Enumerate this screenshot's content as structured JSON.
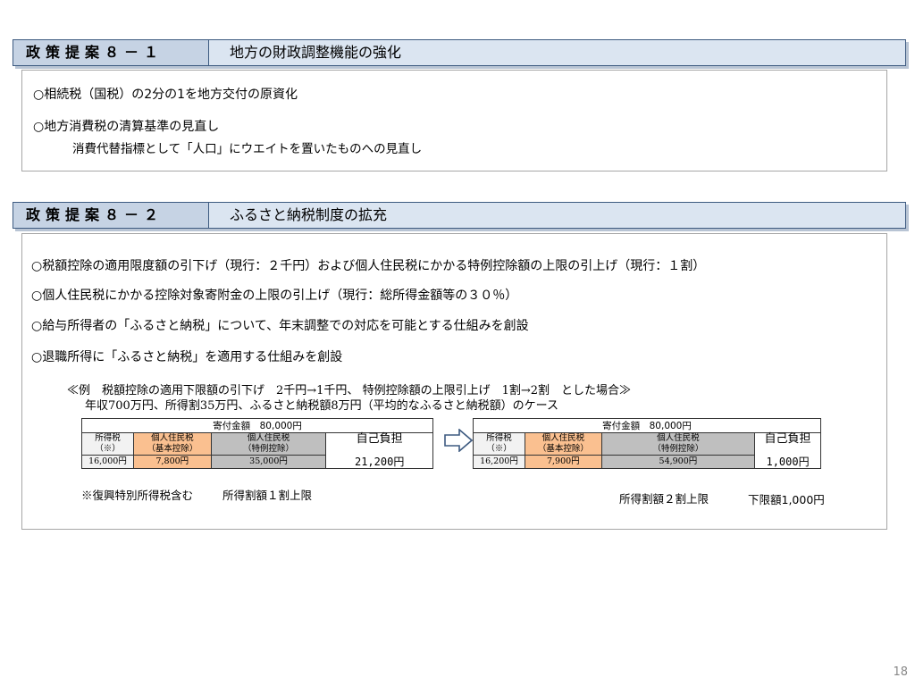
{
  "section1": {
    "label": "政策提案８－１",
    "title": "地方の財政調整機能の強化",
    "bullets": [
      "○相続税（国税）の2分の1を地方交付の原資化",
      "○地方消費税の清算基準の見直し"
    ],
    "sub": "消費代替指標として「人口」にウエイトを置いたものへの見直し"
  },
  "section2": {
    "label": "政策提案８－２",
    "title": "ふるさと納税制度の拡充",
    "bullets": [
      "○税額控除の適用限度額の引下げ（現行：２千円）および個人住民税にかかる特例控除額の上限の引上げ（現行：１割）",
      "○個人住民税にかかる控除対象寄附金の上限の引上げ（現行：総所得金額等の３０％）",
      "○給与所得者の「ふるさと納税」について、年末調整での対応を可能とする仕組みを創設",
      "○退職所得に「ふるさと納税」を適用する仕組みを創設"
    ],
    "example_line1": "≪例　税額控除の適用下限額の引下げ　2千円→1千円、 特例控除額の上限引上げ　1割→2割　とした場合≫",
    "example_line2": "年収700万円、所得割35万円、ふるさと納税額8万円（平均的なふるさと納税額）のケース",
    "table_left": {
      "header": "寄付金額　80,000円",
      "col1_line1": "所得税",
      "col1_line2": "（※）",
      "col1_value": "16,000円",
      "col2_line1": "個人住民税",
      "col2_line2": "（基本控除）",
      "col2_value": "7,800円",
      "col3_line1": "個人住民税",
      "col3_line2": "（特例控除）",
      "col3_value": "35,000円",
      "jiko_label": "自己負担",
      "jiko_value": "21,200円"
    },
    "table_right": {
      "header": "寄付金額　80,000円",
      "col1_line1": "所得税",
      "col1_line2": "（※）",
      "col1_value": "16,200円",
      "col2_line1": "個人住民税",
      "col2_line2": "（基本控除）",
      "col2_value": "7,900円",
      "col3_line1": "個人住民税",
      "col3_line2": "（特例控除）",
      "col3_value": "54,900円",
      "jiko_label": "自己負担",
      "jiko_value": "1,000円"
    },
    "note": "※復興特別所得税含む",
    "cap_left": "所得割額１割上限",
    "cap_right": "所得割額２割上限",
    "lower_limit": "下限額1,000円"
  },
  "page_number": "18",
  "colors": {
    "header_bg": "#dbe5f1",
    "label_bg": "#c6d3e4",
    "orange_cell": "#fac090",
    "gray_cell": "#bfbfbf",
    "arrow": "#3d5a80"
  }
}
